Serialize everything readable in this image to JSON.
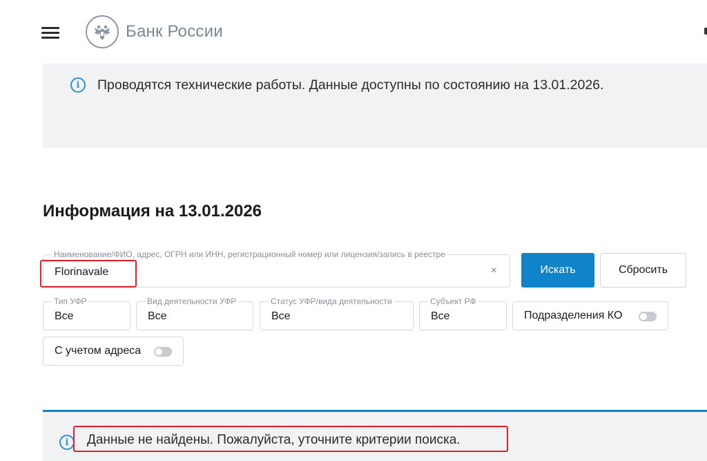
{
  "header": {
    "logo_text": "Банк России",
    "menu_icon": "hamburger-menu-icon",
    "emblem_icon": "double-headed-eagle-icon"
  },
  "maintenance": {
    "message": "Проводятся технические работы. Данные доступны по состоянию на 13.01.2026."
  },
  "page_title": "Информация на 13.01.2026",
  "search": {
    "legend": "Наименование/ФИО, адрес, ОГРН или ИНН, регистрационный номер или лицензия/запись в реестре",
    "value": "Florinavale",
    "clear_icon": "×",
    "search_button": "Искать",
    "reset_button": "Сбросить"
  },
  "filters": {
    "type": {
      "legend": "Тип УФР",
      "value": "Все"
    },
    "activity": {
      "legend": "Вид деятельности УФР",
      "value": "Все"
    },
    "status": {
      "legend": "Статус УФР/вида деятельности",
      "value": "Все"
    },
    "subject": {
      "legend": "Субъект РФ",
      "value": "Все"
    },
    "branches_toggle": {
      "label": "Подразделения КО",
      "on": false
    },
    "address_toggle": {
      "label": "С учетом адреса",
      "on": false
    }
  },
  "result": {
    "message": "Данные не найдены. Пожалуйста, уточните критерии поиска."
  },
  "colors": {
    "accent": "#1183c9",
    "highlight": "#e11d2a",
    "info": "#2f8fd8",
    "banner_bg": "#f1f2f4"
  }
}
